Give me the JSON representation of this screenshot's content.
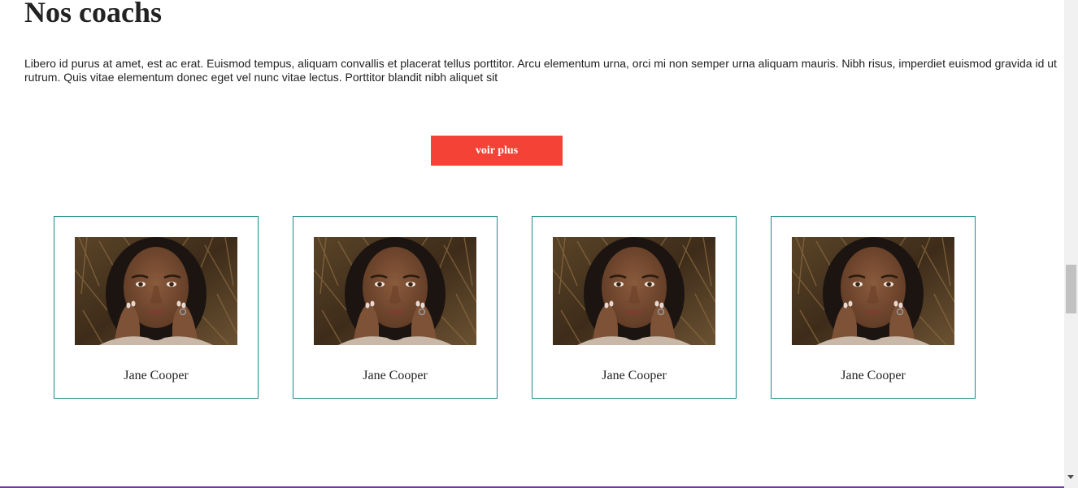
{
  "page": {
    "title": "Nos coachs",
    "intro": "Libero id purus at amet, est ac erat. Euismod tempus, aliquam convallis et placerat tellus porttitor. Arcu elementum urna, orci mi non semper urna aliquam mauris. Nibh risus, imperdiet euismod gravida id ut rutrum. Quis vitae elementum donec eget vel nunc vitae lectus. Porttitor blandit nibh aliquet sit",
    "more_button_label": "voir plus"
  },
  "coaches": [
    {
      "name": "Jane Cooper"
    },
    {
      "name": "Jane Cooper"
    },
    {
      "name": "Jane Cooper"
    },
    {
      "name": "Jane Cooper"
    }
  ],
  "colors": {
    "accent": "#f44336",
    "card_border": "#1a8a8a",
    "text": "#222222",
    "bottom_rule": "#6a3d9a"
  }
}
